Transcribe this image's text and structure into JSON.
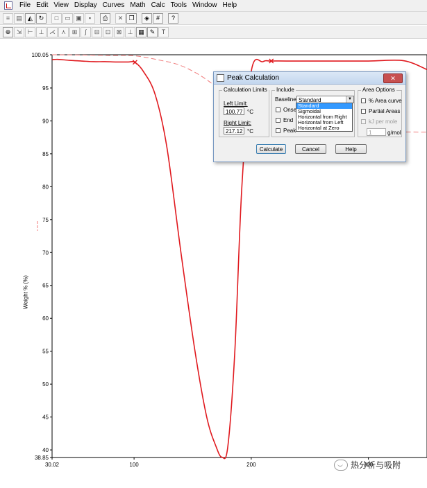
{
  "menu": [
    "File",
    "Edit",
    "View",
    "Display",
    "Curves",
    "Math",
    "Calc",
    "Tools",
    "Window",
    "Help"
  ],
  "toolbar1": [
    {
      "name": "first-icon",
      "glyph": "≡",
      "on": false
    },
    {
      "name": "doc-icon",
      "glyph": "▤",
      "on": false
    },
    {
      "name": "chart-icon",
      "glyph": "◭",
      "on": true
    },
    {
      "name": "refresh-icon",
      "glyph": "↻",
      "on": true
    },
    {
      "name": "sep",
      "glyph": ""
    },
    {
      "name": "new-icon",
      "glyph": "□",
      "on": false
    },
    {
      "name": "open-icon",
      "glyph": "▭",
      "on": false
    },
    {
      "name": "save-all-icon",
      "glyph": "▣",
      "on": false
    },
    {
      "name": "save-icon",
      "glyph": "▪",
      "on": false
    },
    {
      "name": "sep",
      "glyph": ""
    },
    {
      "name": "print-icon",
      "glyph": "⎙",
      "on": true
    },
    {
      "name": "sep",
      "glyph": ""
    },
    {
      "name": "cut-icon",
      "glyph": "✕",
      "on": false
    },
    {
      "name": "copy-icon",
      "glyph": "❐",
      "on": true
    },
    {
      "name": "sep",
      "glyph": ""
    },
    {
      "name": "paste-icon",
      "glyph": "◈",
      "on": true
    },
    {
      "name": "grid-icon",
      "glyph": "#",
      "on": true
    },
    {
      "name": "sep",
      "glyph": ""
    },
    {
      "name": "context-help-icon",
      "glyph": "?",
      "on": true
    }
  ],
  "toolbar2": [
    {
      "name": "zoom-icon",
      "glyph": "⊕",
      "on": true
    },
    {
      "name": "rescale-icon",
      "glyph": "⇲",
      "on": false
    },
    {
      "name": "cursor-icon",
      "glyph": "⊢",
      "on": false
    },
    {
      "name": "step-icon",
      "glyph": "⊥",
      "on": false
    },
    {
      "name": "onset-icon",
      "glyph": "⋌",
      "on": false
    },
    {
      "name": "peak-icon",
      "glyph": "⋏",
      "on": false
    },
    {
      "name": "area-icon",
      "glyph": "⊞",
      "on": false
    },
    {
      "name": "integral-icon",
      "glyph": "∫",
      "on": false
    },
    {
      "name": "baseline-icon",
      "glyph": "⊟",
      "on": false
    },
    {
      "name": "signal-icon",
      "glyph": "⊡",
      "on": false
    },
    {
      "name": "marker-icon",
      "glyph": "⊠",
      "on": false
    },
    {
      "name": "label-icon",
      "glyph": "⊥",
      "on": false
    },
    {
      "name": "table-icon",
      "glyph": "▦",
      "on": true
    },
    {
      "name": "pen-icon",
      "glyph": "✎",
      "on": true
    },
    {
      "name": "text-icon",
      "glyph": "T",
      "on": false
    }
  ],
  "dialog": {
    "title": "Peak Calculation",
    "close": "✕",
    "calc_limits": {
      "title": "Calculation Limits",
      "left_label": "Left Limit:",
      "left_value": "100.77",
      "right_label": "Right Limit:",
      "right_value": "217.12",
      "unit": "°C"
    },
    "include": {
      "title": "Include",
      "baseline_label": "Baseline:",
      "baseline_value": "Standard",
      "onset": "Onset",
      "end": "End",
      "peak": "Peak",
      "options": [
        "Standard",
        "Sigmoidal",
        "Horizontal from Right",
        "Horizontal from Left",
        "Horizontal at Zero"
      ]
    },
    "area": {
      "title": "Area Options",
      "pct_area": "% Area curve",
      "partial": "Partial Areas",
      "kj": "kJ per mole",
      "mole_value": "1",
      "unit": "g/mol"
    },
    "buttons": {
      "calculate": "Calculate",
      "cancel": "Cancel",
      "help": "Help"
    }
  },
  "watermark": "热分析与吸附",
  "chart_data": {
    "type": "line",
    "ylabel": "Weight % (%)",
    "ylim": [
      38.85,
      100.05
    ],
    "xlim": [
      30.02,
      350
    ],
    "yticks": [
      "100.05",
      "95",
      "90",
      "85",
      "80",
      "75",
      "70",
      "65",
      "60",
      "55",
      "50",
      "45",
      "40",
      "38.85"
    ],
    "ytick_values": [
      100.05,
      95,
      90,
      85,
      80,
      75,
      70,
      65,
      60,
      55,
      50,
      45,
      40,
      38.85
    ],
    "xticks": [
      "30.02",
      "100",
      "200",
      "300"
    ],
    "xtick_values": [
      30.02,
      100,
      200,
      300
    ],
    "colors": {
      "derivative": "#e0191e",
      "weight": "#f07a7a"
    },
    "series": [
      {
        "role": "derivative",
        "style": "solid",
        "x": [
          30.02,
          35,
          45,
          55,
          65,
          75,
          85,
          95,
          100.77,
          108,
          118,
          128,
          140,
          152,
          162,
          170,
          175,
          180,
          186,
          192,
          200,
          210,
          217.12,
          230,
          260,
          300,
          330,
          350
        ],
        "y": [
          99.3,
          99.35,
          99.2,
          99.1,
          99.0,
          99.0,
          98.95,
          98.95,
          98.9,
          97.5,
          94,
          86,
          70,
          55,
          45,
          40.5,
          38.9,
          40.5,
          55,
          80,
          97.5,
          99,
          99.1,
          99.1,
          99.1,
          99.1,
          99.15,
          97.8
        ]
      },
      {
        "role": "weight",
        "style": "dashed",
        "x": [
          30.02,
          50,
          80,
          100,
          120,
          140,
          160,
          175,
          185,
          195,
          210,
          230,
          260,
          300,
          350
        ],
        "y": [
          100.05,
          100.02,
          99.95,
          99.9,
          99.3,
          98.4,
          96.5,
          94.2,
          91.2,
          89.2,
          88.5,
          88.4,
          88.35,
          88.35,
          88.3
        ]
      }
    ],
    "markers": [
      {
        "x": 100.77,
        "y": 98.9
      },
      {
        "x": 217.12,
        "y": 99.1
      }
    ]
  }
}
